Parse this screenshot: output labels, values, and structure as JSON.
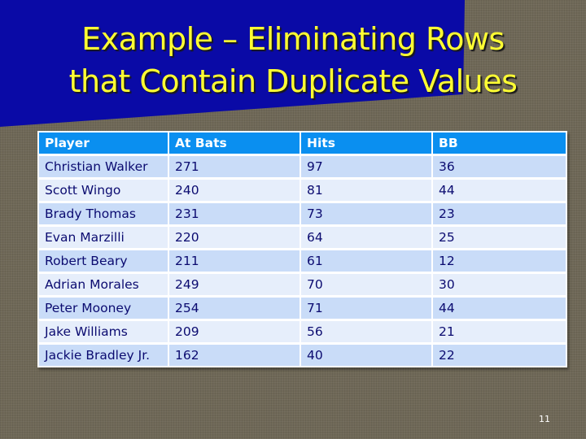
{
  "slide": {
    "title_line1": "Example – Eliminating Rows",
    "title_line2": "that Contain Duplicate Values",
    "page_number": "11",
    "colors": {
      "banner": "#0a0aa6",
      "title_text": "#ffff33",
      "header_bg": "#0a8ff0",
      "row_odd_bg": "#c9dcf8",
      "row_even_bg": "#e6eefb",
      "cell_text": "#0b0b70"
    }
  },
  "table": {
    "headers": [
      "Player",
      "At Bats",
      "Hits",
      "BB"
    ],
    "rows": [
      [
        "Christian Walker",
        "271",
        "97",
        "36"
      ],
      [
        "Scott Wingo",
        "240",
        "81",
        "44"
      ],
      [
        "Brady Thomas",
        "231",
        "73",
        "23"
      ],
      [
        "Evan Marzilli",
        "220",
        "64",
        "25"
      ],
      [
        "Robert Beary",
        "211",
        "61",
        "12"
      ],
      [
        "Adrian Morales",
        "249",
        "70",
        "30"
      ],
      [
        "Peter Mooney",
        "254",
        "71",
        "44"
      ],
      [
        "Jake Williams",
        "209",
        "56",
        "21"
      ],
      [
        "Jackie Bradley Jr.",
        "162",
        "40",
        "22"
      ]
    ]
  }
}
